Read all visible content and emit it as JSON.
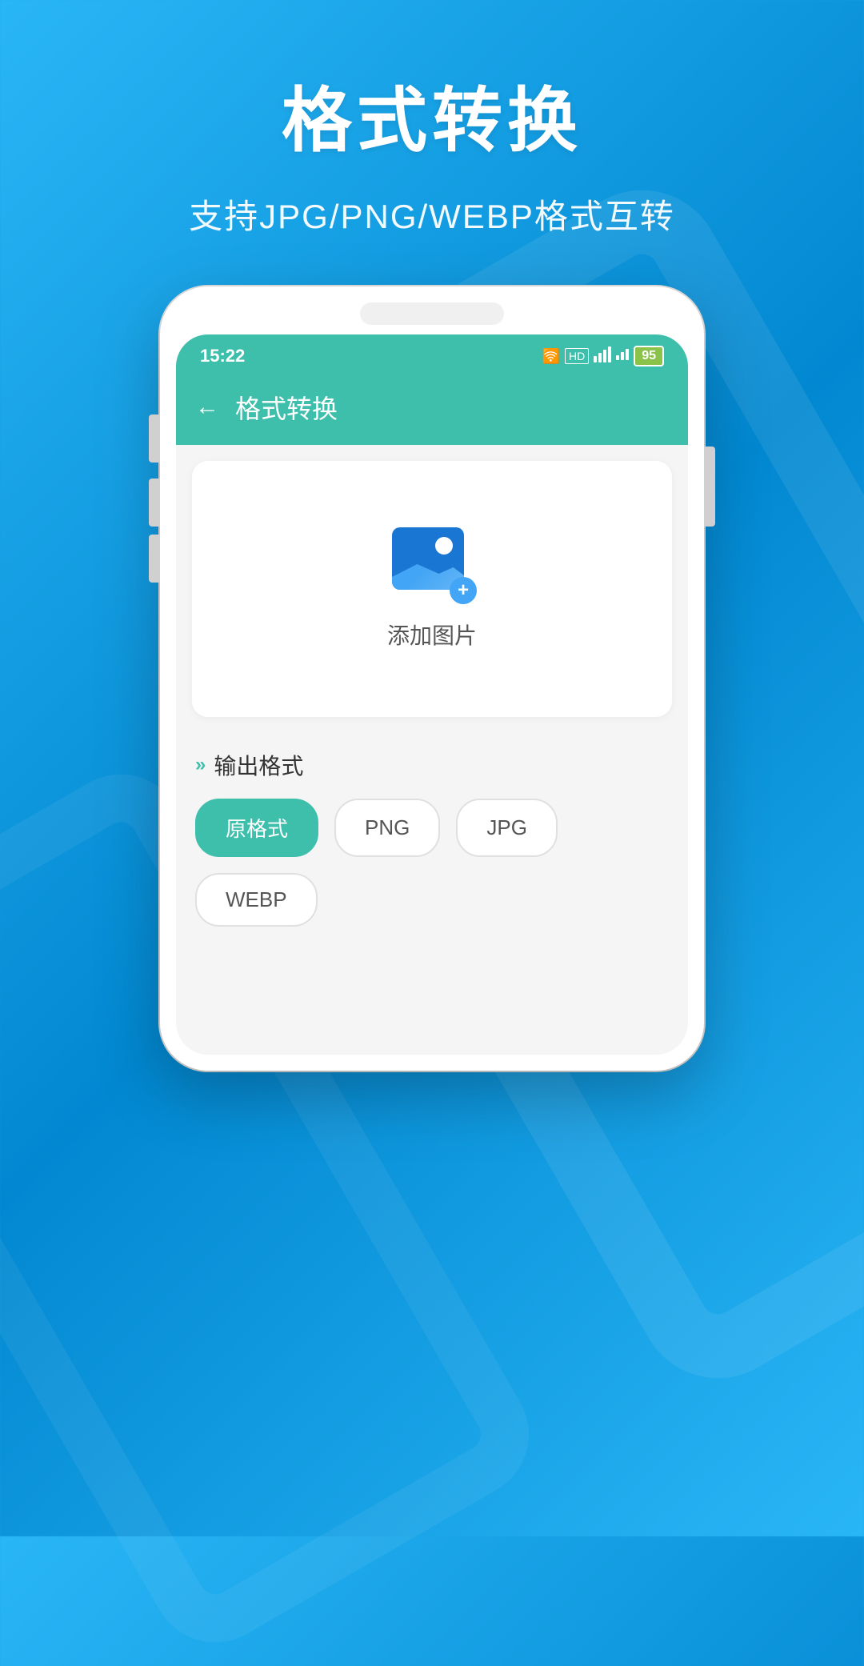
{
  "background": {
    "gradient_start": "#29b6f6",
    "gradient_end": "#0288d1"
  },
  "top_section": {
    "main_title": "格式转换",
    "sub_title": "支持JPG/PNG/WEBP格式互转"
  },
  "phone": {
    "status_bar": {
      "time": "15:22",
      "battery": "95",
      "wifi": "WiFi",
      "signal": "4G"
    },
    "app_bar": {
      "title": "格式转换",
      "back_label": "←"
    },
    "add_image": {
      "text": "添加图片"
    },
    "output_format": {
      "section_label": "输出格式",
      "formats": [
        {
          "label": "原格式",
          "active": true
        },
        {
          "label": "PNG",
          "active": false
        },
        {
          "label": "JPG",
          "active": false
        },
        {
          "label": "WEBP",
          "active": false
        }
      ]
    }
  }
}
